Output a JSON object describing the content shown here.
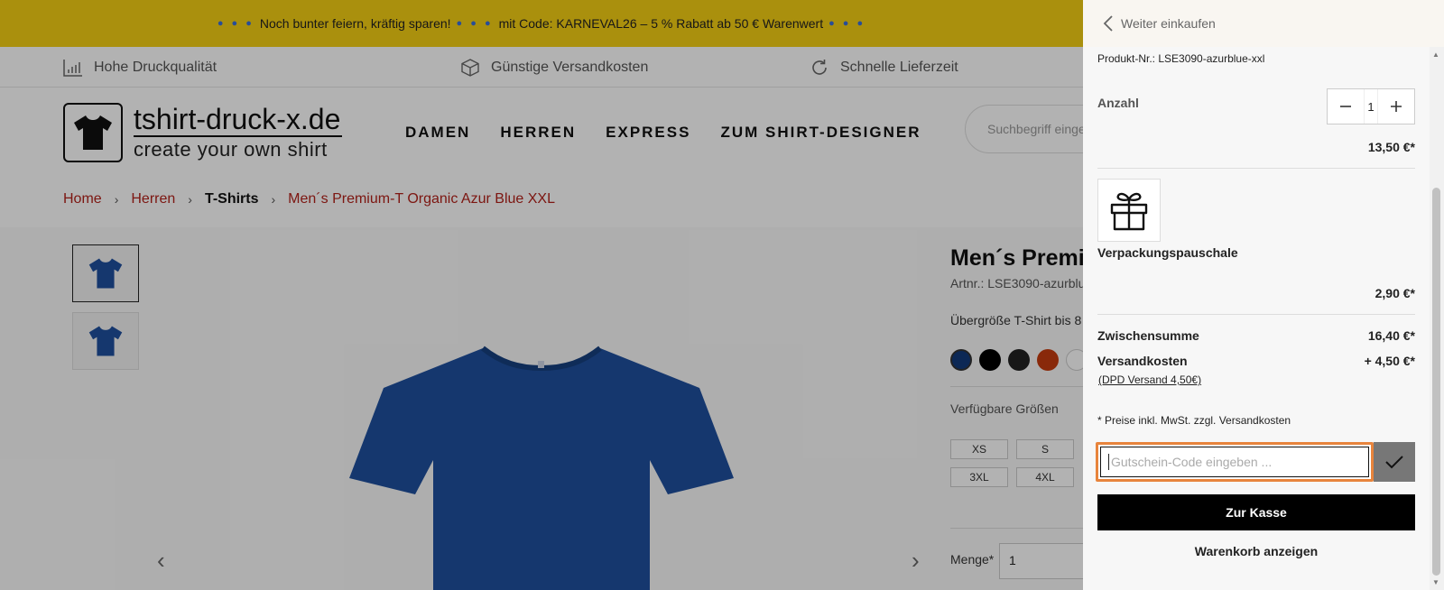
{
  "promo": {
    "dots": "● ● ●",
    "text1": "Noch bunter feiern, kräftig sparen!",
    "text2": "mit Code: KARNEVAL26 – 5 % Rabatt ab 50 € Warenwert"
  },
  "usp": [
    "Hohe Druckqualität",
    "Günstige Versandkosten",
    "Schnelle Lieferzeit"
  ],
  "logo": {
    "name": "tshirt-druck-x.de",
    "tagline": "create your own shirt"
  },
  "nav": [
    "DAMEN",
    "HERREN",
    "EXPRESS",
    "ZUM SHIRT-DESIGNER"
  ],
  "search": {
    "placeholder": "Suchbegriff einge"
  },
  "breadcrumb": [
    "Home",
    "Herren",
    "T-Shirts",
    "Men´s Premium-T Organic Azur Blue XXL"
  ],
  "product": {
    "title": "Men´s Premiu",
    "artnr": "Artnr.: LSE3090-azurblu",
    "desc": "Übergröße T-Shirt bis 8",
    "colors": [
      "#123a7a",
      "#000000",
      "#222222",
      "#c43b0f",
      "#ffffff"
    ],
    "sizes_label": "Verfügbare Größen",
    "sizes": [
      "XS",
      "S",
      "3XL",
      "4XL"
    ],
    "qty_label": "Menge*",
    "qty": "1"
  },
  "cart": {
    "back_label": "Weiter einkaufen",
    "product_nr": "Produkt-Nr.: LSE3090-azurblue-xxl",
    "anzahl_label": "Anzahl",
    "quantity": "1",
    "price_item": "13,50 €*",
    "package_name": "Verpackungspauschale",
    "price_package": "2,90 €*",
    "subtotal_label": "Zwischensumme",
    "subtotal": "16,40 €*",
    "shipping_label": "Versandkosten",
    "shipping": "+ 4,50 €*",
    "shipping_method": "(DPD Versand 4,50€)",
    "vat_note": "* Preise inkl. MwSt. zzgl. Versandkosten",
    "voucher_placeholder": "Gutschein-Code eingeben ...",
    "checkout_label": "Zur Kasse",
    "view_cart_label": "Warenkorb anzeigen"
  }
}
